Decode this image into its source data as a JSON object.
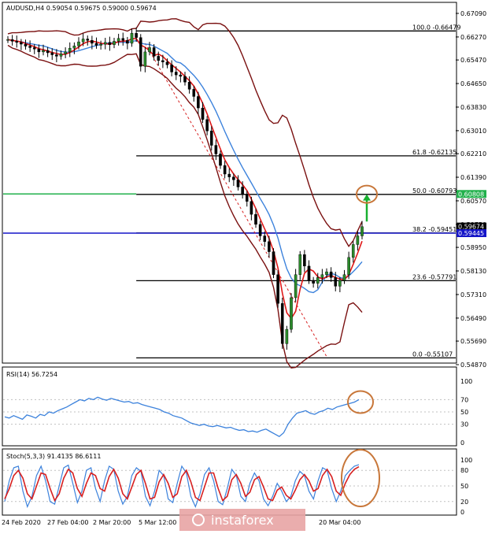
{
  "chart_data": [
    {
      "type": "candlestick",
      "header": "AUDUSD,H4  0.59054 0.59675 0.59000 0.59674",
      "y_ticks": [
        "0.67090",
        "0.66270",
        "0.65470",
        "0.64650",
        "0.63830",
        "0.63010",
        "0.62210",
        "0.61390",
        "0.60570",
        "0.59750",
        "0.58950",
        "0.58130",
        "0.57310",
        "0.56490",
        "0.55690",
        "0.54870"
      ],
      "ylim": [
        0.5487,
        0.6709
      ],
      "fib_levels": [
        {
          "label": "100.0 -0.66479",
          "value": 0.66479
        },
        {
          "label": "61.8 -0.62135",
          "value": 0.62135
        },
        {
          "label": "50.0 -0.60793",
          "value": 0.60793
        },
        {
          "label": "38.2 -0.59451",
          "value": 0.59451
        },
        {
          "label": "23.6 -0.57791",
          "value": 0.57791
        },
        {
          "label": "0.0 -0.55107",
          "value": 0.55107
        }
      ],
      "price_tags": [
        {
          "text": "0.60808",
          "value": 0.60808,
          "color": "#22b14c"
        },
        {
          "text": "0.59674",
          "value": 0.59674,
          "color": "#000000"
        },
        {
          "text": "0.59445",
          "value": 0.59445,
          "color": "#1515c8"
        }
      ],
      "close_prices": [
        0.6618,
        0.6612,
        0.6608,
        0.6602,
        0.6595,
        0.659,
        0.6585,
        0.6575,
        0.658,
        0.6572,
        0.6565,
        0.656,
        0.6568,
        0.6575,
        0.6588,
        0.6596,
        0.661,
        0.662,
        0.6615,
        0.6605,
        0.6598,
        0.6602,
        0.6608,
        0.66,
        0.6612,
        0.6622,
        0.6615,
        0.6605,
        0.664,
        0.6625,
        0.6525,
        0.6575,
        0.659,
        0.656,
        0.6545,
        0.654,
        0.653,
        0.6505,
        0.6495,
        0.649,
        0.647,
        0.6445,
        0.642,
        0.638,
        0.634,
        0.63,
        0.625,
        0.622,
        0.618,
        0.615,
        0.614,
        0.613,
        0.6105,
        0.608,
        0.6055,
        0.601,
        0.5975,
        0.5935,
        0.5915,
        0.588,
        0.58,
        0.57,
        0.556,
        0.561,
        0.572,
        0.58,
        0.587,
        0.583,
        0.578,
        0.577,
        0.579,
        0.58,
        0.581,
        0.579,
        0.576,
        0.578,
        0.58,
        0.586,
        0.5905,
        0.5935,
        0.5967
      ],
      "annotations": []
    },
    {
      "type": "line",
      "title": "RSI(14) 56.7254",
      "y_ticks": [
        "100",
        "70",
        "50",
        "30",
        "0"
      ],
      "ylim": [
        0,
        100
      ],
      "values": [
        42,
        40,
        44,
        41,
        38,
        45,
        43,
        40,
        46,
        44,
        50,
        48,
        52,
        55,
        58,
        62,
        66,
        70,
        68,
        72,
        70,
        74,
        71,
        69,
        72,
        70,
        68,
        66,
        67,
        64,
        65,
        62,
        60,
        58,
        56,
        54,
        50,
        48,
        44,
        42,
        40,
        36,
        32,
        30,
        28,
        30,
        27,
        26,
        28,
        26,
        24,
        25,
        22,
        20,
        21,
        18,
        19,
        17,
        20,
        22,
        18,
        14,
        10,
        16,
        30,
        40,
        48,
        50,
        52,
        48,
        46,
        50,
        52,
        56,
        54,
        58,
        60,
        62,
        64,
        66,
        70
      ]
    },
    {
      "type": "line",
      "title": "Stoch(5,3,3) 91.4135 86.6111",
      "y_ticks": [
        "100",
        "80",
        "50",
        "20",
        "0"
      ],
      "ylim": [
        0,
        100
      ],
      "x_ticks": [
        "24 Feb 2020",
        "27 Feb 04:00",
        "2 Mar 20:00",
        "5 Mar 12:00",
        "20 Mar 04:00"
      ],
      "series": [
        {
          "name": "%K",
          "color": "#3c82dc",
          "values": [
            20,
            60,
            85,
            88,
            40,
            10,
            30,
            70,
            88,
            60,
            20,
            15,
            50,
            85,
            90,
            55,
            18,
            40,
            80,
            85,
            45,
            20,
            60,
            88,
            82,
            40,
            15,
            30,
            70,
            85,
            78,
            30,
            12,
            40,
            80,
            70,
            25,
            18,
            55,
            88,
            75,
            30,
            10,
            35,
            72,
            85,
            60,
            20,
            14,
            45,
            82,
            70,
            30,
            20,
            55,
            75,
            60,
            25,
            12,
            30,
            55,
            40,
            20,
            30,
            60,
            78,
            70,
            40,
            25,
            60,
            85,
            80,
            45,
            20,
            40,
            70,
            80,
            88,
            91
          ]
        },
        {
          "name": "%D",
          "color": "#d72020",
          "values": [
            25,
            45,
            70,
            80,
            65,
            35,
            25,
            50,
            75,
            72,
            45,
            22,
            35,
            65,
            82,
            75,
            45,
            30,
            55,
            75,
            70,
            45,
            40,
            68,
            82,
            65,
            35,
            25,
            48,
            72,
            80,
            55,
            25,
            28,
            58,
            72,
            55,
            28,
            35,
            68,
            80,
            58,
            28,
            22,
            48,
            75,
            75,
            45,
            22,
            30,
            62,
            72,
            55,
            30,
            38,
            62,
            68,
            48,
            25,
            22,
            42,
            48,
            32,
            25,
            42,
            62,
            72,
            60,
            40,
            45,
            70,
            82,
            68,
            40,
            32,
            55,
            72,
            82,
            87
          ]
        }
      ]
    }
  ],
  "watermark": "instaforex"
}
